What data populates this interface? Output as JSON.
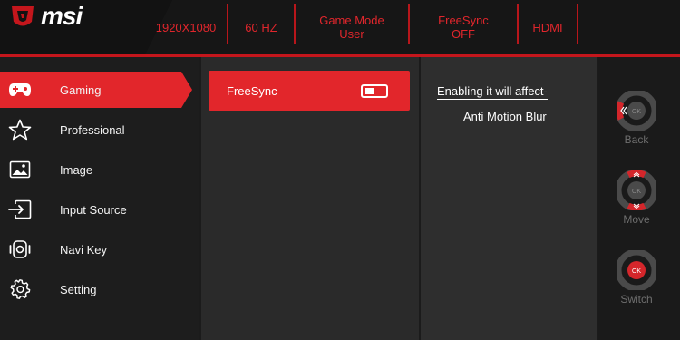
{
  "brand": {
    "name": "msi"
  },
  "status_bar": [
    {
      "lines": [
        "1920X1080"
      ]
    },
    {
      "lines": [
        "60 HZ"
      ]
    },
    {
      "lines": [
        "Game Mode",
        "User"
      ]
    },
    {
      "lines": [
        "FreeSync",
        "OFF"
      ]
    },
    {
      "lines": [
        "HDMI"
      ]
    }
  ],
  "menu": {
    "items": [
      {
        "label": "Gaming",
        "icon": "gamepad-icon",
        "active": true
      },
      {
        "label": "Professional",
        "icon": "star-icon",
        "active": false
      },
      {
        "label": "Image",
        "icon": "image-icon",
        "active": false
      },
      {
        "label": "Input Source",
        "icon": "input-source-icon",
        "active": false
      },
      {
        "label": "Navi Key",
        "icon": "navi-key-icon",
        "active": false
      },
      {
        "label": "Setting",
        "icon": "gear-icon",
        "active": false
      }
    ]
  },
  "submenu": {
    "option_label": "FreeSync",
    "toggle_state": "off"
  },
  "info": {
    "title": "Enabling it will affect-",
    "items": [
      "Anti Motion Blur"
    ]
  },
  "navi_keys": [
    {
      "label": "Back",
      "icon": "joystick-back-icon"
    },
    {
      "label": "Move",
      "icon": "joystick-move-icon"
    },
    {
      "label": "Switch",
      "icon": "joystick-switch-icon"
    }
  ],
  "colors": {
    "accent": "#e2262b",
    "status_text": "#e0262c",
    "background": "#1b1b1b"
  }
}
